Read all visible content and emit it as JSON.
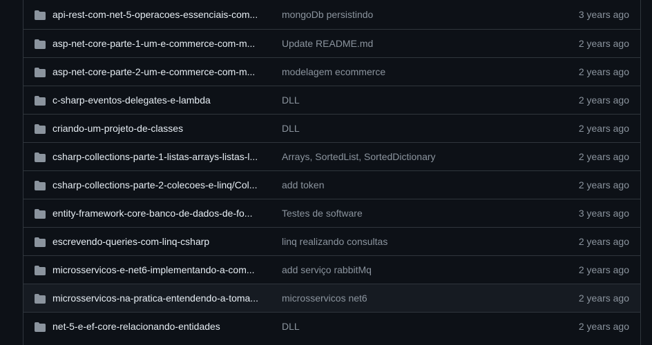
{
  "colors": {
    "background": "#0d1117",
    "border": "#30363d",
    "row_hover": "#161b22",
    "folder_icon": "#8b949e",
    "name_text": "#e6edf3",
    "muted_text": "#8b949e"
  },
  "icons": {
    "folder": "folder-icon"
  },
  "rows": [
    {
      "name": "api-rest-com-net-5-operacoes-essenciais-com...",
      "commit": "mongoDb persistindo",
      "age": "3 years ago"
    },
    {
      "name": "asp-net-core-parte-1-um-e-commerce-com-m...",
      "commit": "Update README.md",
      "age": "2 years ago"
    },
    {
      "name": "asp-net-core-parte-2-um-e-commerce-com-m...",
      "commit": "modelagem ecommerce",
      "age": "2 years ago"
    },
    {
      "name": "c-sharp-eventos-delegates-e-lambda",
      "commit": "DLL",
      "age": "2 years ago"
    },
    {
      "name": "criando-um-projeto-de-classes",
      "commit": "DLL",
      "age": "2 years ago"
    },
    {
      "name": "csharp-collections-parte-1-listas-arrays-listas-l...",
      "commit": "Arrays, SortedList, SortedDictionary",
      "age": "2 years ago"
    },
    {
      "name": "csharp-collections-parte-2-colecoes-e-linq/Col...",
      "commit": "add token",
      "age": "2 years ago"
    },
    {
      "name": "entity-framework-core-banco-de-dados-de-fo...",
      "commit": "Testes de software",
      "age": "3 years ago"
    },
    {
      "name": "escrevendo-queries-com-linq-csharp",
      "commit": "linq realizando consultas",
      "age": "2 years ago"
    },
    {
      "name": "microsservicos-e-net6-implementando-a-com...",
      "commit": "add serviço rabbitMq",
      "age": "2 years ago"
    },
    {
      "name": "microsservicos-na-pratica-entendendo-a-toma...",
      "commit": "microsservicos net6",
      "age": "2 years ago"
    },
    {
      "name": "net-5-e-ef-core-relacionando-entidades",
      "commit": "DLL",
      "age": "2 years ago"
    }
  ]
}
